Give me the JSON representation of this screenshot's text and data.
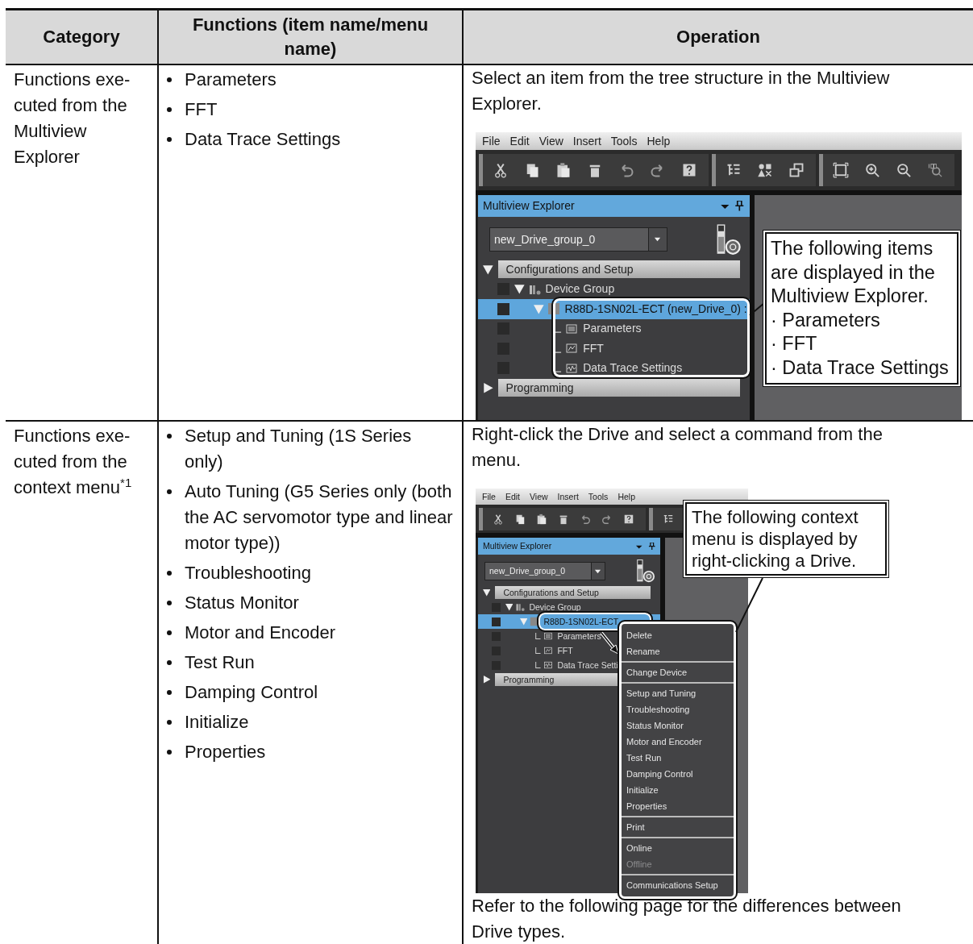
{
  "table": {
    "columns": [
      "Category",
      "Functions (item name/menu name)",
      "Operation"
    ],
    "rows": [
      {
        "category": "Functions exe-cuted from the Multiview Explorer",
        "functions": [
          "Parameters",
          "FFT",
          "Data Trace Settings"
        ],
        "operation": {
          "intro": "Select an item from the tree structure in the Multiview Explorer.",
          "screenshot": {
            "kind": "tree_callout",
            "menu": [
              "File",
              "Edit",
              "View",
              "Insert",
              "Tools",
              "Help"
            ],
            "panel_title": "Multiview Explorer",
            "group_select": "new_Drive_group_0",
            "tree": [
              {
                "label": "Configurations and Setup",
                "expanded": true,
                "selected": false,
                "children": [
                  {
                    "label": "Device Group",
                    "kind": "group",
                    "expanded": true,
                    "selected": false,
                    "children": [
                      {
                        "label": "R88D-1SN02L-ECT (new_Drive_0) :",
                        "kind": "drive",
                        "expanded": true,
                        "selected": true,
                        "children": [
                          {
                            "label": "Parameters",
                            "kind": "parameters",
                            "selected": false
                          },
                          {
                            "label": "FFT",
                            "kind": "fft",
                            "selected": false
                          },
                          {
                            "label": "Data Trace Settings",
                            "kind": "trace",
                            "selected": false
                          }
                        ]
                      }
                    ]
                  }
                ]
              },
              {
                "label": "Programming",
                "expanded": false,
                "selected": false
              }
            ],
            "callout": [
              "The following items",
              "are displayed in the",
              "Multiview Explorer.",
              "· Parameters",
              "· FFT",
              "· Data Trace Settings"
            ]
          }
        }
      },
      {
        "category": "Functions exe-cuted from the context menu$^{*1}$",
        "functions": [
          "Setup and Tuning (1S Series only)",
          "Auto Tuning (G5 Series only (both the AC servomotor type and linear motor type))",
          "Troubleshooting",
          "Status Monitor",
          "Motor and Encoder",
          "Test Run",
          "Damping Control",
          "Initialize",
          "Properties"
        ],
        "operation": {
          "intro": "Right-click the Drive and select a command from the menu.",
          "screenshot": {
            "kind": "context_menu",
            "menu": [
              "File",
              "Edit",
              "View",
              "Insert",
              "Tools",
              "Help"
            ],
            "panel_title": "Multiview Explorer",
            "group_select": "new_Drive_group_0",
            "tree": [
              {
                "label": "Configurations and Setup",
                "expanded": true,
                "selected": false,
                "children": [
                  {
                    "label": "Device Group",
                    "kind": "group",
                    "expanded": true,
                    "selected": false,
                    "children": [
                      {
                        "label": "R88D-1SN02L-ECT",
                        "kind": "drive",
                        "expanded": true,
                        "selected": true,
                        "children": [
                          {
                            "label": "Parameters",
                            "kind": "parameters",
                            "selected": false
                          },
                          {
                            "label": "FFT",
                            "kind": "fft",
                            "selected": false
                          },
                          {
                            "label": "Data Trace Setti",
                            "kind": "trace",
                            "selected": false
                          }
                        ]
                      }
                    ]
                  }
                ]
              },
              {
                "label": "Programming",
                "expanded": false,
                "selected": false
              }
            ],
            "callout": [
              "The following context",
              "menu is displayed by",
              "right-clicking a Drive."
            ],
            "context_menu": [
              {
                "items": [
                  {
                    "label": "Delete",
                    "disabled": false
                  },
                  {
                    "label": "Rename",
                    "disabled": false
                  }
                ]
              },
              {
                "items": [
                  {
                    "label": "Change Device",
                    "disabled": false
                  }
                ]
              },
              {
                "items": [
                  {
                    "label": "Setup and Tuning",
                    "disabled": false
                  },
                  {
                    "label": "Troubleshooting",
                    "disabled": false
                  },
                  {
                    "label": "Status Monitor",
                    "disabled": false
                  },
                  {
                    "label": "Motor and Encoder",
                    "disabled": false
                  },
                  {
                    "label": "Test Run",
                    "disabled": false
                  },
                  {
                    "label": "Damping Control",
                    "disabled": false
                  },
                  {
                    "label": "Initialize",
                    "disabled": false
                  },
                  {
                    "label": "Properties",
                    "disabled": false
                  }
                ]
              },
              {
                "items": [
                  {
                    "label": "Print",
                    "disabled": false
                  }
                ]
              },
              {
                "items": [
                  {
                    "label": "Online",
                    "disabled": false
                  },
                  {
                    "label": "Offline",
                    "disabled": true
                  }
                ]
              },
              {
                "items": [
                  {
                    "label": "Communications Setup",
                    "disabled": false
                  }
                ]
              }
            ]
          },
          "note": "Refer to the following page for the differences between Drive types."
        }
      }
    ]
  }
}
